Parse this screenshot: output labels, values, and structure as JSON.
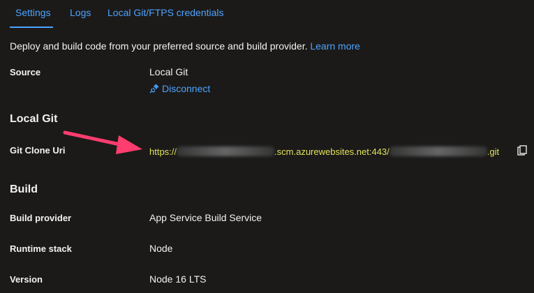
{
  "tabs": [
    {
      "label": "Settings",
      "active": true
    },
    {
      "label": "Logs",
      "active": false
    },
    {
      "label": "Local Git/FTPS credentials",
      "active": false
    }
  ],
  "description": {
    "text": "Deploy and build code from your preferred source and build provider.",
    "link": "Learn more"
  },
  "source": {
    "label": "Source",
    "value": "Local Git",
    "action": "Disconnect"
  },
  "local_git": {
    "heading": "Local Git",
    "clone_uri_label": "Git Clone Uri",
    "uri_prefix": "https://",
    "uri_middle": ".scm.azurewebsites.net:443/",
    "uri_suffix": ".git"
  },
  "build": {
    "heading": "Build",
    "provider_label": "Build provider",
    "provider_value": "App Service Build Service",
    "runtime_label": "Runtime stack",
    "runtime_value": "Node",
    "version_label": "Version",
    "version_value": "Node 16 LTS"
  },
  "colors": {
    "background": "#1b1a19",
    "accent": "#4da3ff",
    "uri_text": "#e3e35a",
    "annotation_arrow": "#ff3d6e"
  },
  "icons": {
    "disconnect": "plug-icon",
    "copy": "copy-icon",
    "annotation": "arrow-icon"
  }
}
